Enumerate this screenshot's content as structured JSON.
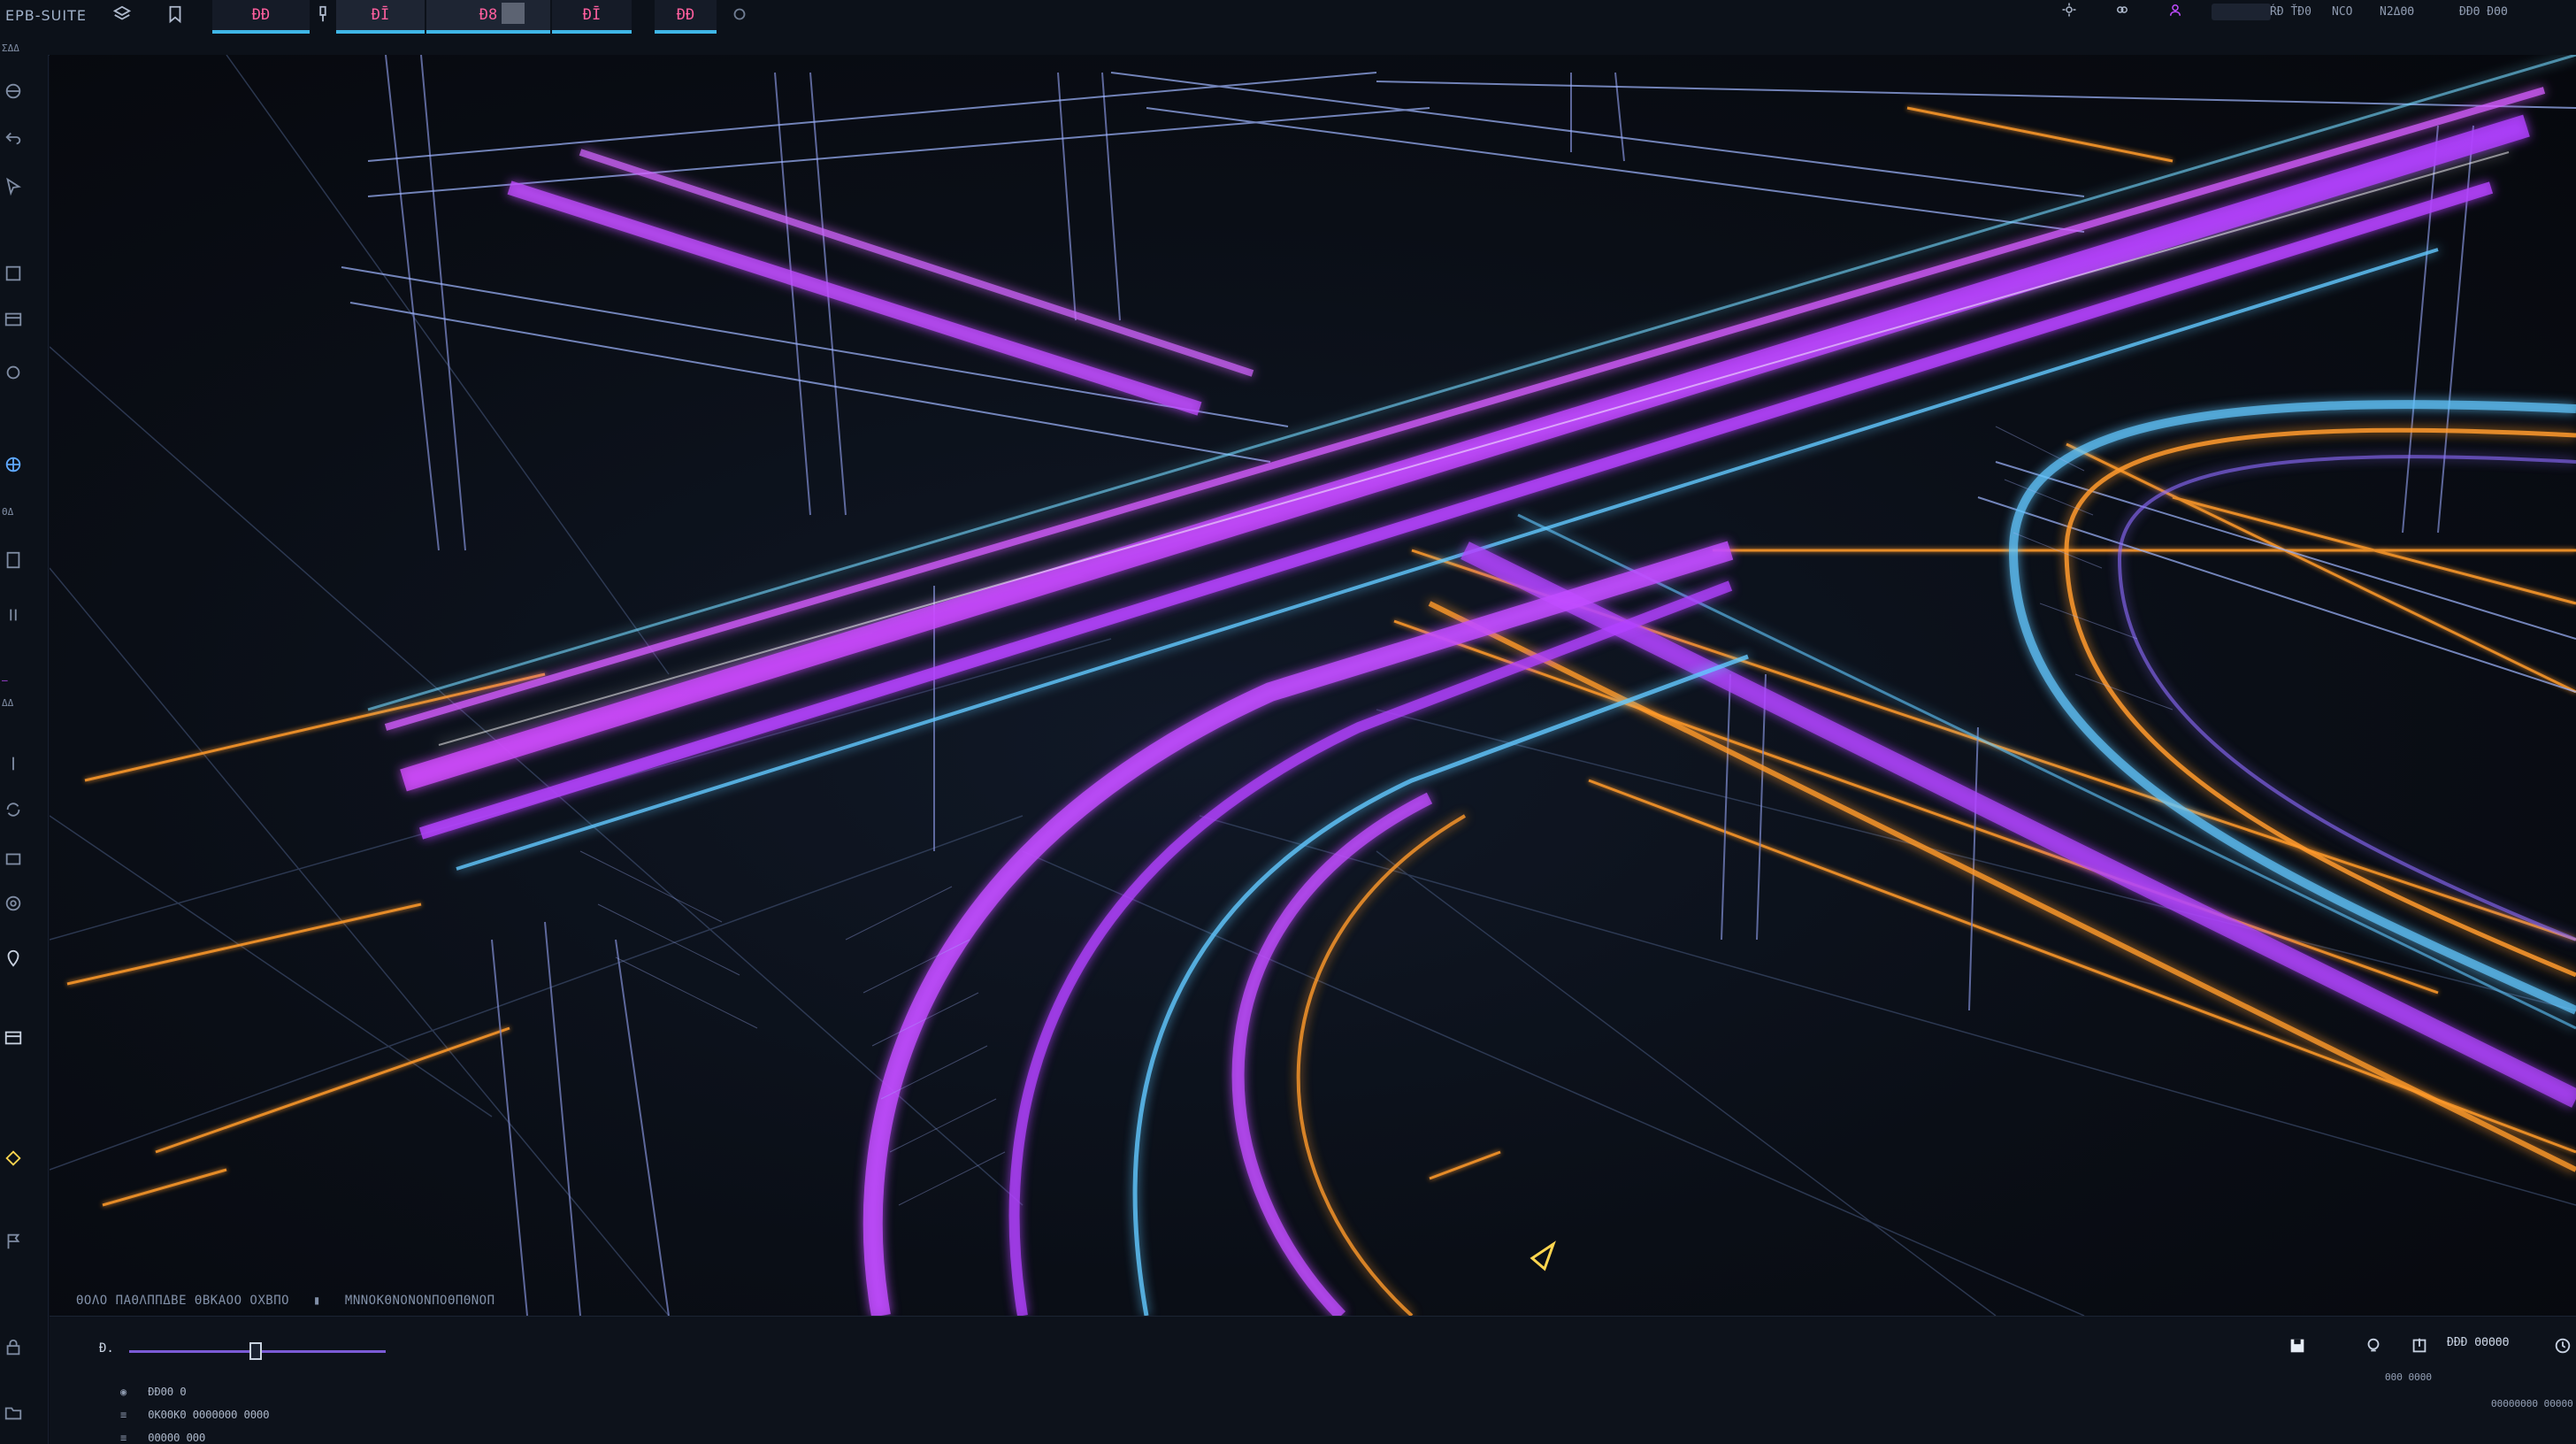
{
  "app": {
    "brand": "EPB-SUITE"
  },
  "toolbar": {
    "tools": [
      {
        "icon": "layers-icon"
      },
      {
        "icon": "bookmark-icon"
      }
    ],
    "tabs": [
      {
        "label": "ĐĐ",
        "icon": "tab-icon-1"
      },
      {
        "label": "",
        "icon": "pin-icon"
      },
      {
        "label": "ĐĪ",
        "icon": "tab-icon-2"
      },
      {
        "label": "Đ8",
        "icon": "tab-icon-3"
      },
      {
        "label": "ĐĪ",
        "icon": "tab-icon-4"
      },
      {
        "label": "ĐĐ",
        "icon": "tab-icon-5"
      }
    ],
    "settings_icon": "circle-dot-icon"
  },
  "status_bar": {
    "items": [
      "ŔĐ ŤĐ0",
      "NCO",
      "N2ΔΘΘ",
      "ĐĐΘ ĐΘΘ"
    ]
  },
  "left_rail": {
    "labels": [
      "ΣΔΔ",
      "ΘΔ",
      "ΔΔ"
    ]
  },
  "viewport": {
    "caption_left": "ΘΟΛΟ ΠΑΘΛΠΠΔΒΕ   ΘΒΚΑΟΟ ΟΧΒΠΟ",
    "caption_right": "ΜΝΝΟΚΘΝΟΝΟΝΠΟΘΠΘΝΟΠ"
  },
  "bottom_panel": {
    "timeline_label": "Đ.",
    "layers": [
      {
        "name": "ĐĐΘΘ Θ"
      },
      {
        "name": "ΘΚΘΘΚΘ ΘΘΘΘΘΘΘ ΘΘΘΘ"
      },
      {
        "name": "ΘΘΘΘΘ ΘΘΘ"
      }
    ],
    "right_label": "ĐĐĐ ΘΘΘΘΘ",
    "right_sub": "ΘΘΘ   ΘΘΘΘ",
    "right_footer": "ΘΘΘΘΘΘΘΘ ΘΘΘΘΘ"
  },
  "colors": {
    "accent_magenta": "#c04cff",
    "accent_cyan": "#5fd0ff",
    "accent_orange": "#ff9a2b",
    "tab_text": "#ff5f9e"
  }
}
